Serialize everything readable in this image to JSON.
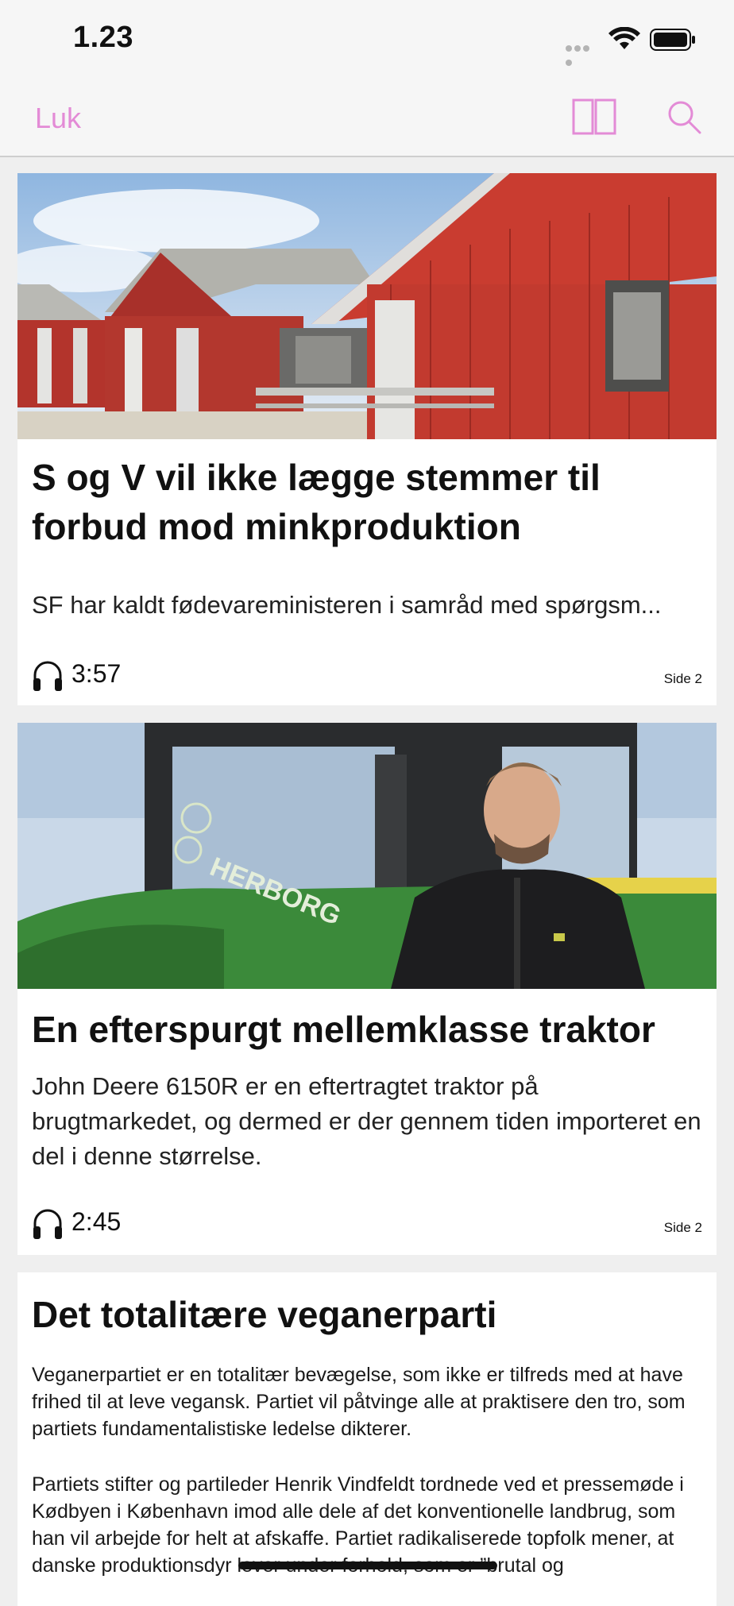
{
  "status_bar": {
    "time": "1.23",
    "icons": [
      "cellular-signal-icon",
      "wifi-icon",
      "battery-icon"
    ]
  },
  "nav": {
    "close_label": "Luk",
    "icons": [
      "two-page-layout-icon",
      "search-icon"
    ],
    "accent_color": "#e38bd6"
  },
  "articles": [
    {
      "image": "photo of red mink farm barns",
      "title": "S og V vil ikke lægge stemmer til forbud mod minkproduktion",
      "lead": "SF har kaldt fødevareministeren i samråd med spørgsm...",
      "audio_duration": "3:57",
      "page": "Side 2"
    },
    {
      "image": "photo of man in front of green John Deere tractor",
      "title": "En efterspurgt mellemklasse traktor",
      "lead": "John Deere 6150R er en eftertragtet traktor på brugtmarkedet, og dermed er der gennem tiden importeret en del i denne størrelse.",
      "audio_duration": "2:45",
      "page": "Side 2"
    },
    {
      "title": "Det totalitære veganerparti",
      "paragraphs": [
        "Veganerpartiet er en totalitær bevægelse, som ikke er tilfreds med at have frihed til at leve vegansk. Partiet vil påtvinge alle at praktisere den tro, som partiets fundamentalistiske ledelse dikterer.",
        "Partiets stifter og partileder Henrik Vindfeldt tordnede ved et pressemøde i Kødbyen i København imod alle dele af det konventionelle landbrug, som han vil arbejde for helt at afskaffe. Partiet radikaliserede topfolk mener, at danske produktionsdyr lever under forhold, som er ”brutal og"
      ]
    }
  ]
}
